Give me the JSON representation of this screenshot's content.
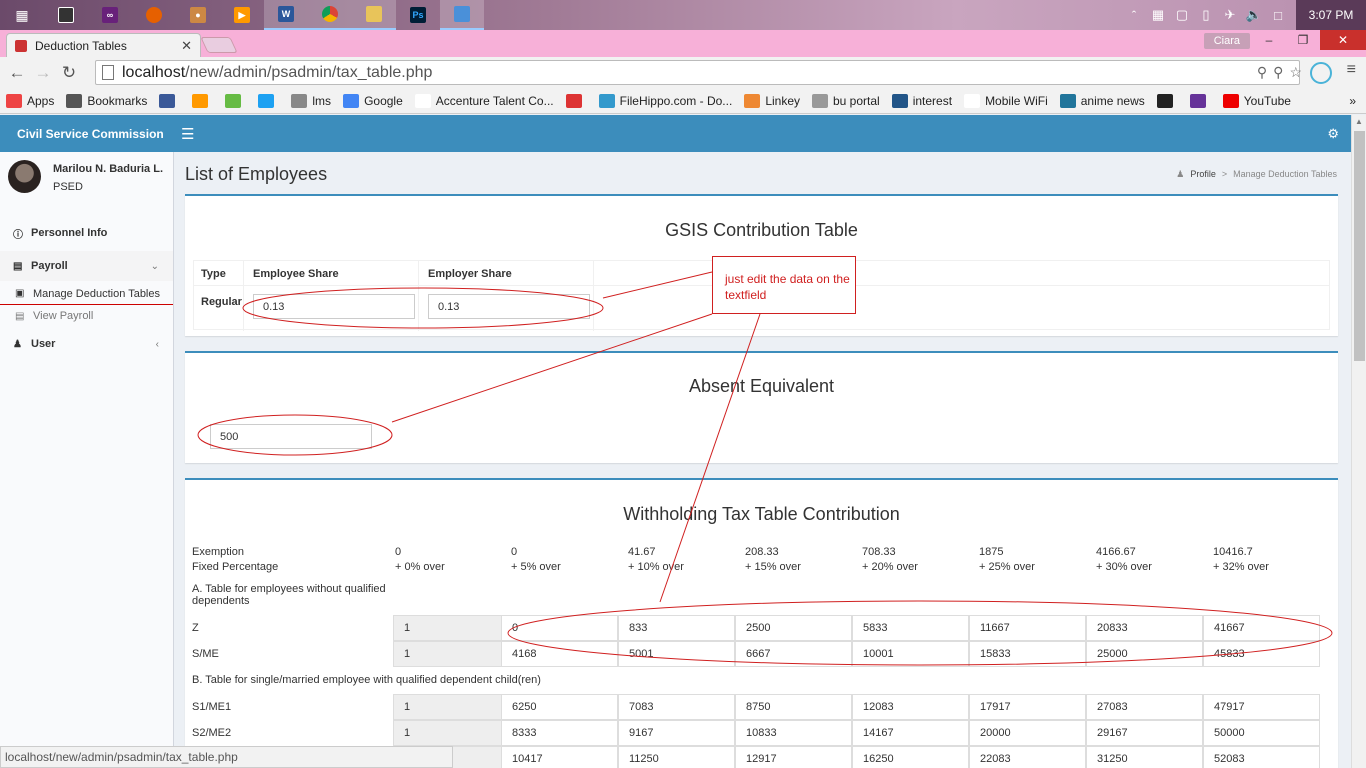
{
  "taskbar": {
    "apps": [
      "windows-start-icon",
      "task-view-icon",
      "visual-studio-icon",
      "firefox-icon",
      "paint-icon",
      "media-icon",
      "word-icon",
      "chrome-icon",
      "file-explorer-icon",
      "photoshop-icon",
      "photo-viewer-icon"
    ],
    "word_badge": "W",
    "ps_badge": "Ps",
    "clock": "3:07 PM"
  },
  "browser": {
    "tab_title": "Deduction Tables",
    "profile": "Ciara",
    "url_host": "localhost",
    "url_path": "/new/admin/psadmin/tax_table.php",
    "status_url": "localhost/new/admin/psadmin/tax_table.php"
  },
  "bookmarks": [
    {
      "label": "Apps",
      "icon": "apps-grid-icon",
      "color": "#e44"
    },
    {
      "label": "Bookmarks",
      "icon": "star-icon",
      "color": "#555"
    },
    {
      "label": "",
      "icon": "facebook-icon",
      "color": "#3b5998"
    },
    {
      "label": "",
      "icon": "pma-icon",
      "color": "#f90"
    },
    {
      "label": "",
      "icon": "bookmark-green-icon",
      "color": "#6b4"
    },
    {
      "label": "",
      "icon": "twitter-icon",
      "color": "#1da1f2"
    },
    {
      "label": "lms",
      "icon": "lms-icon",
      "color": "#888"
    },
    {
      "label": "Google",
      "icon": "google-icon",
      "color": "#4285f4"
    },
    {
      "label": "Accenture Talent Co...",
      "icon": "accenture-icon",
      "color": "#fff"
    },
    {
      "label": "",
      "icon": "gmail-icon",
      "color": "#d33"
    },
    {
      "label": "FileHippo.com - Do...",
      "icon": "filehippo-icon",
      "color": "#39c"
    },
    {
      "label": "Linkey",
      "icon": "linkey-icon",
      "color": "#e83"
    },
    {
      "label": "bu portal",
      "icon": "page-icon",
      "color": "#999"
    },
    {
      "label": "interest",
      "icon": "interest-icon",
      "color": "#258"
    },
    {
      "label": "Mobile WiFi",
      "icon": "wifi-icon",
      "color": "#fff"
    },
    {
      "label": "anime news",
      "icon": "wordpress-icon",
      "color": "#21759b"
    },
    {
      "label": "",
      "icon": "layers-icon",
      "color": "#222"
    },
    {
      "label": "",
      "icon": "az-icon",
      "color": "#639"
    },
    {
      "label": "YouTube",
      "icon": "youtube-icon",
      "color": "#e00"
    }
  ],
  "app": {
    "brand": "Civil Service Commission",
    "user_name": "Marilou N. Baduria L.",
    "user_role": "PSED",
    "menu": {
      "personnel": "Personnel Info",
      "payroll": "Payroll",
      "manage": "Manage Deduction Tables",
      "view_payroll": "View Payroll",
      "user": "User"
    },
    "page_title": "List of Employees",
    "breadcrumb": {
      "profile": "Profile",
      "sep": ">",
      "current": "Manage Deduction Tables"
    }
  },
  "gsis": {
    "title": "GSIS Contribution Table",
    "headers": {
      "type": "Type",
      "employee": "Employee Share",
      "employer": "Employer Share"
    },
    "row_label": "Regular",
    "employee_share": "0.13",
    "employer_share": "0.13"
  },
  "absent": {
    "title": "Absent Equivalent",
    "value": "500"
  },
  "tax": {
    "title": "Withholding Tax Table Contribution",
    "exemption_label": "Exemption",
    "fixed_label": "Fixed Percentage",
    "exemptions": [
      "0",
      "0",
      "41.67",
      "208.33",
      "708.33",
      "1875",
      "4166.67",
      "10416.7"
    ],
    "percentages": [
      "+ 0% over",
      "+ 5% over",
      "+ 10% over",
      "+ 15% over",
      "+ 20% over",
      "+ 25% over",
      "+ 30% over",
      "+ 32% over"
    ],
    "section_a": "A. Table for employees without qualified dependents",
    "section_b": "B. Table for single/married employee with qualified dependent child(ren)",
    "rows_a": [
      {
        "label": "Z",
        "values": [
          "1",
          "0",
          "833",
          "2500",
          "5833",
          "11667",
          "20833",
          "41667"
        ]
      },
      {
        "label": "S/ME",
        "values": [
          "1",
          "4168",
          "5001",
          "6667",
          "10001",
          "15833",
          "25000",
          "45833"
        ]
      }
    ],
    "rows_b": [
      {
        "label": "S1/ME1",
        "values": [
          "1",
          "6250",
          "7083",
          "8750",
          "12083",
          "17917",
          "27083",
          "47917"
        ]
      },
      {
        "label": "S2/ME2",
        "values": [
          "1",
          "8333",
          "9167",
          "10833",
          "14167",
          "20000",
          "29167",
          "50000"
        ]
      },
      {
        "label": "",
        "values": [
          "",
          "10417",
          "11250",
          "12917",
          "16250",
          "22083",
          "31250",
          "52083"
        ]
      }
    ]
  },
  "annotation": {
    "note": "just edit the data on the textfield",
    "color": "#d02020"
  }
}
